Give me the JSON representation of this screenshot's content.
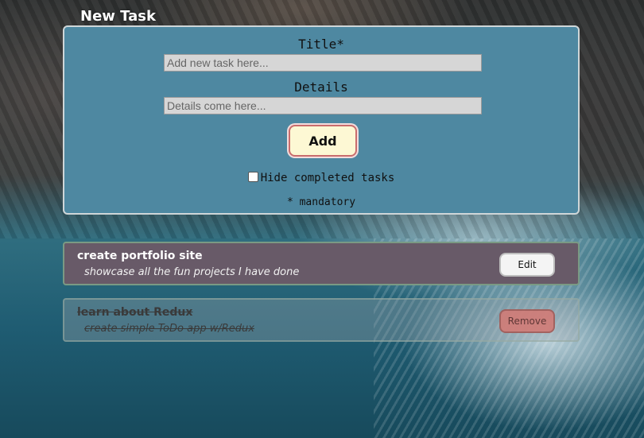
{
  "form": {
    "heading": "New Task",
    "title_label": "Title*",
    "title_placeholder": "Add new task here...",
    "title_value": "",
    "details_label": "Details",
    "details_placeholder": "Details come here...",
    "details_value": "",
    "add_label": "Add",
    "hide_completed_label": "Hide completed tasks",
    "hide_completed_checked": false,
    "mandatory_note": "* mandatory"
  },
  "tasks": [
    {
      "title": "create portfolio site",
      "details": "showcase all the fun projects I have done",
      "completed": false,
      "action_label": "Edit"
    },
    {
      "title": "learn about Redux",
      "details": "create simple ToDo app w/Redux",
      "completed": true,
      "action_label": "Remove"
    }
  ],
  "colors": {
    "form_panel": "#4e88a1",
    "active_task": "#685a68",
    "add_button": "#fdf8d4",
    "remove_button": "#d27b76"
  }
}
